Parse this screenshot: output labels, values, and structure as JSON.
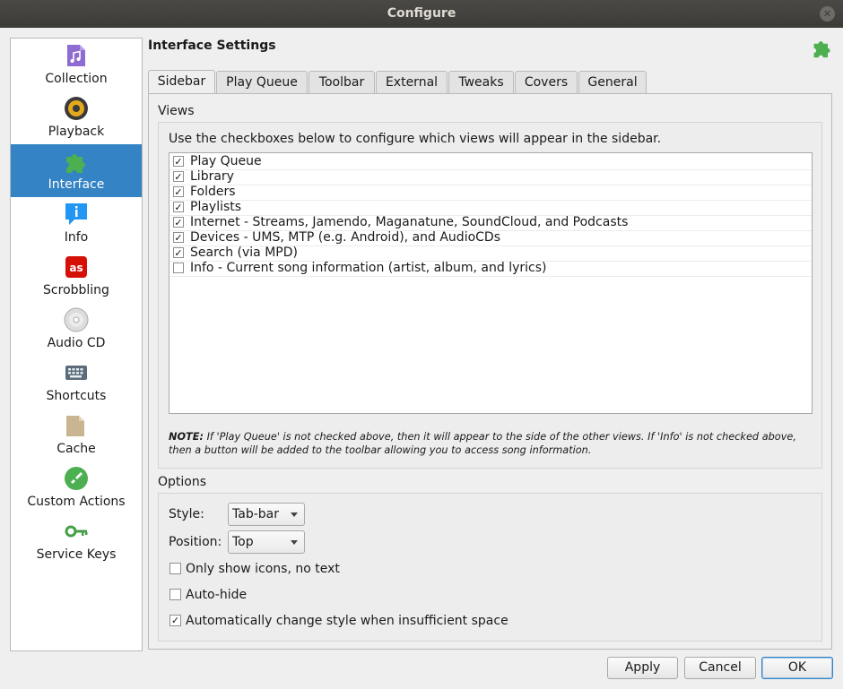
{
  "window": {
    "title": "Configure"
  },
  "sidebar": {
    "items": [
      {
        "label": "Collection",
        "icon": "music-file-icon"
      },
      {
        "label": "Playback",
        "icon": "speaker-icon"
      },
      {
        "label": "Interface",
        "icon": "puzzle-icon",
        "selected": true
      },
      {
        "label": "Info",
        "icon": "info-bubble-icon"
      },
      {
        "label": "Scrobbling",
        "icon": "lastfm-icon"
      },
      {
        "label": "Audio CD",
        "icon": "cd-icon"
      },
      {
        "label": "Shortcuts",
        "icon": "keyboard-icon"
      },
      {
        "label": "Cache",
        "icon": "folder-icon"
      },
      {
        "label": "Custom Actions",
        "icon": "rocket-icon"
      },
      {
        "label": "Service Keys",
        "icon": "key-icon"
      }
    ]
  },
  "main": {
    "title": "Interface Settings",
    "tabs": [
      "Sidebar",
      "Play Queue",
      "Toolbar",
      "External",
      "Tweaks",
      "Covers",
      "General"
    ],
    "active_tab": "Sidebar",
    "views": {
      "title": "Views",
      "instructions": "Use the checkboxes below to configure which views will appear in the sidebar.",
      "items": [
        {
          "label": "Play Queue",
          "checked": true
        },
        {
          "label": "Library",
          "checked": true
        },
        {
          "label": "Folders",
          "checked": true
        },
        {
          "label": "Playlists",
          "checked": true
        },
        {
          "label": "Internet - Streams, Jamendo, Maganatune, SoundCloud, and Podcasts",
          "checked": true
        },
        {
          "label": "Devices - UMS, MTP (e.g. Android), and AudioCDs",
          "checked": true
        },
        {
          "label": "Search (via MPD)",
          "checked": true
        },
        {
          "label": "Info - Current song information (artist, album, and lyrics)",
          "checked": false
        }
      ],
      "note_prefix": "NOTE:",
      "note_text": " If 'Play Queue' is not checked above, then it will appear to the side of the other views. If 'Info' is not checked above, then a button will be added to the toolbar allowing you to access song information."
    },
    "options": {
      "title": "Options",
      "style_label": "Style:",
      "style_value": "Tab-bar",
      "position_label": "Position:",
      "position_value": "Top",
      "only_icons_label": "Only show icons, no text",
      "only_icons_checked": false,
      "auto_hide_label": "Auto-hide",
      "auto_hide_checked": false,
      "auto_change_label": "Automatically change style when insufficient space",
      "auto_change_checked": true
    }
  },
  "buttons": {
    "apply": "Apply",
    "cancel": "Cancel",
    "ok": "OK"
  },
  "colors": {
    "selection": "#3483c4",
    "titlebar": "#3c3b37",
    "puzzle": "#4caf50"
  }
}
